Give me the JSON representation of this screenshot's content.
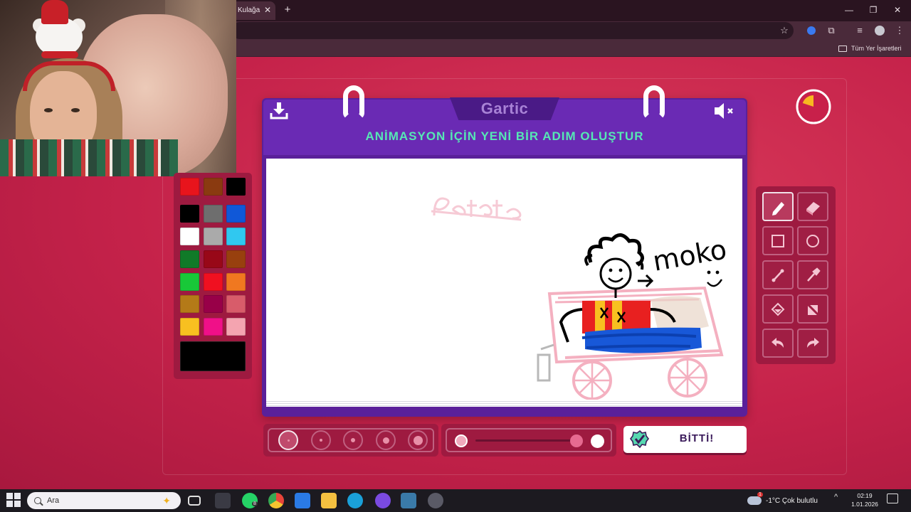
{
  "browser": {
    "tab_title": "Kulağa",
    "tab_close": "✕",
    "new_tab": "+",
    "bookmarks_folder": "Tüm Yer İşaretleri"
  },
  "game": {
    "brand": "Gartic",
    "title": "ANİMASYON İÇİN YENİ BİR ADIM OLUŞTUR",
    "done_label": "BİTTİ!",
    "timer_fraction_remaining": 0.2,
    "drawing_labels": {
      "crossed_word": "Patates",
      "character_name": "moko"
    }
  },
  "palette": {
    "colors": [
      "#e8141c",
      "#8a3a10",
      "#000000",
      "#000000",
      "#6e6e6e",
      "#1058d8",
      "#ffffff",
      "#aaaaaa",
      "#30c8f0",
      "#107a28",
      "#980818",
      "#98400e",
      "#18c838",
      "#f01020",
      "#f07820",
      "#b47a18",
      "#980048",
      "#d85c6a",
      "#f8c020",
      "#f01088",
      "#f4a4b0"
    ],
    "selected_color": "#000000"
  },
  "tools": [
    "pencil-icon",
    "eraser-icon",
    "rectangle-icon",
    "ellipse-icon",
    "line-icon",
    "eyedropper-icon",
    "fill-icon",
    "clear-icon",
    "undo-icon",
    "redo-icon"
  ],
  "brush": {
    "selected_size_index": 0,
    "opacity_level": 0.9
  },
  "taskbar": {
    "search_placeholder": "Ara",
    "whatsapp_badge": "8",
    "weather": "-1°C  Çok bulutlu",
    "weather_badge": "1",
    "time": "02:19",
    "date": "1.01.2026"
  },
  "colors": {
    "accent_green": "#56e8b4",
    "dialog_purple": "#5a209a",
    "page_red": "#c8204a"
  }
}
